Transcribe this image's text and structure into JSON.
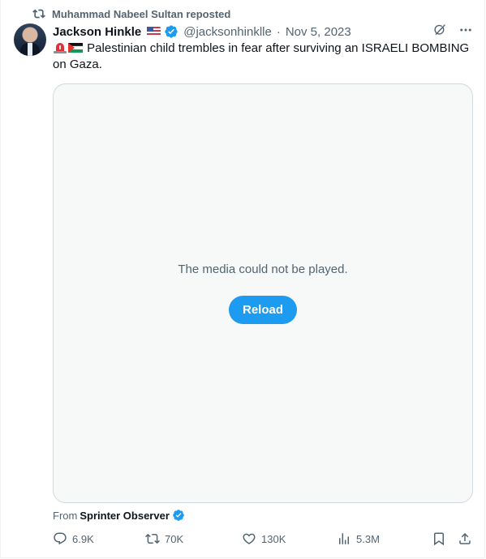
{
  "repost": {
    "text": "Muhammad Nabeel Sultan reposted"
  },
  "tweet": {
    "author_name": "Jackson Hinkle",
    "handle": "@jacksonhinklle",
    "separator": "·",
    "date": "Nov 5, 2023",
    "text": "Palestinian child trembles in fear after surviving an ISRAELI BOMBING on Gaza.",
    "text_emojis": [
      "siren-emoji",
      "palestine-flag-emoji"
    ]
  },
  "media": {
    "message": "The media could not be played.",
    "reload_label": "Reload"
  },
  "source": {
    "prefix": "From",
    "name": "Sprinter Observer"
  },
  "metrics": {
    "replies": "6.9K",
    "reposts": "70K",
    "likes": "130K",
    "views": "5.3M"
  },
  "colors": {
    "accent": "#1d9bf0",
    "text_secondary": "#536471",
    "border": "#cfd9de"
  }
}
